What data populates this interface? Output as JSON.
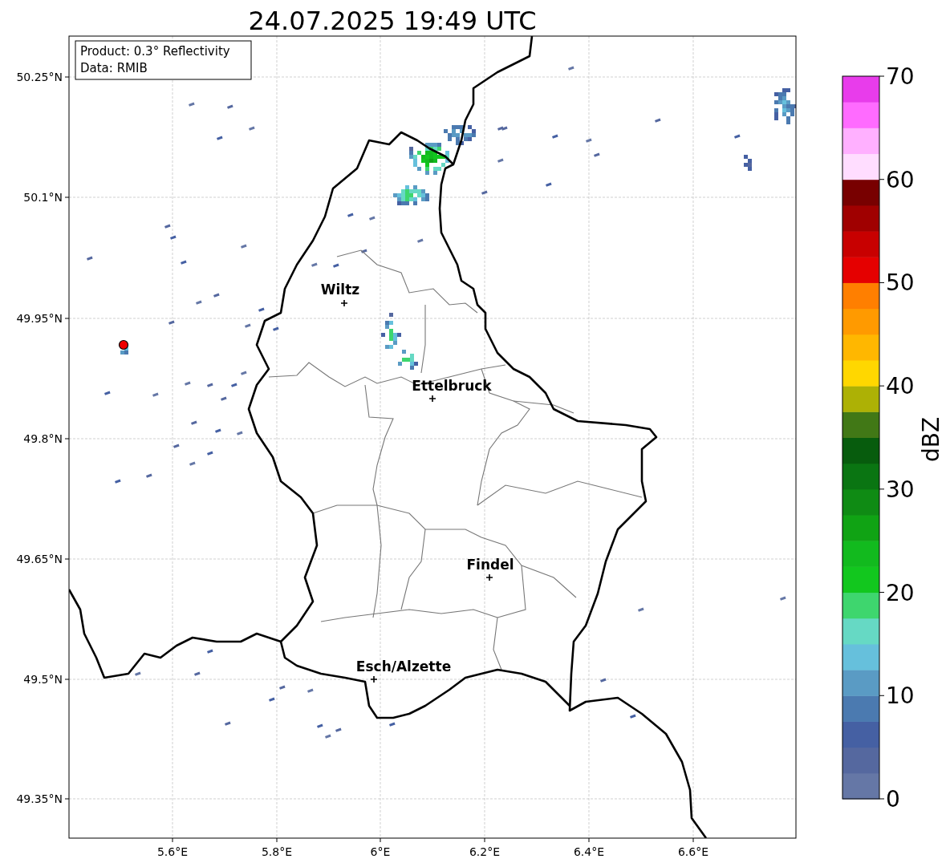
{
  "title": "24.07.2025 19:49 UTC",
  "info_box": [
    "Product: 0.3° Reflectivity",
    "Data: RMIB"
  ],
  "y_axis": {
    "ticks": [
      "50.25°N",
      "50.1°N",
      "49.95°N",
      "49.8°N",
      "49.65°N",
      "49.5°N",
      "49.35°N"
    ]
  },
  "x_axis": {
    "ticks": [
      "5.6°E",
      "5.8°E",
      "6°E",
      "6.2°E",
      "6.4°E",
      "6.6°E"
    ]
  },
  "cities": [
    {
      "name": "Wiltz"
    },
    {
      "name": "Ettelbruck"
    },
    {
      "name": "Findel"
    },
    {
      "name": "Esch/Alzette"
    }
  ],
  "colorbar": {
    "label": "dBZ",
    "ticks": [
      "70",
      "60",
      "50",
      "40",
      "30",
      "20",
      "10",
      "0"
    ],
    "bands": [
      {
        "color": "#6577a6"
      },
      {
        "color": "#55689f"
      },
      {
        "color": "#4560a3"
      },
      {
        "color": "#4b7ab0"
      },
      {
        "color": "#5a9bc4"
      },
      {
        "color": "#66c0dc"
      },
      {
        "color": "#66d9c4"
      },
      {
        "color": "#3ed66e"
      },
      {
        "color": "#12c71e"
      },
      {
        "color": "#12ba1e"
      },
      {
        "color": "#10a314"
      },
      {
        "color": "#0f8b14"
      },
      {
        "color": "#0a7512"
      },
      {
        "color": "#075c0d"
      },
      {
        "color": "#417816"
      },
      {
        "color": "#adb105"
      },
      {
        "color": "#ffd700"
      },
      {
        "color": "#ffb700"
      },
      {
        "color": "#ff9a00"
      },
      {
        "color": "#ff7f00"
      },
      {
        "color": "#e50000"
      },
      {
        "color": "#c80000"
      },
      {
        "color": "#a00000"
      },
      {
        "color": "#780000"
      },
      {
        "color": "#ffddff"
      },
      {
        "color": "#ffb0ff"
      },
      {
        "color": "#ff6bff"
      },
      {
        "color": "#e83ceb"
      }
    ]
  }
}
